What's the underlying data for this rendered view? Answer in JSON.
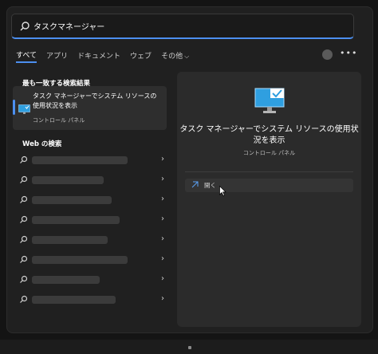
{
  "search": {
    "query": "タスクマネージャー",
    "placeholder": ""
  },
  "tabs": [
    {
      "label": "すべて"
    },
    {
      "label": "アプリ"
    },
    {
      "label": "ドキュメント"
    },
    {
      "label": "ウェブ"
    },
    {
      "label": "その他",
      "chevron": "chevron-down-icon"
    }
  ],
  "header": {
    "more": "•••"
  },
  "left": {
    "best_match_heading": "最も一致する検索結果",
    "best_match": {
      "title": "タスク マネージャーでシステム リソースの使用状況を表示",
      "subtitle": "コントロール パネル",
      "icon": "monitor-check-icon"
    },
    "web_heading": "Web の検索",
    "web_results_count_visible": 8
  },
  "detail": {
    "title": "タスク マネージャーでシステム リソースの使用状況を表示",
    "subtitle": "コントロール パネル",
    "actions": [
      {
        "label": "開く",
        "icon": "open-icon"
      }
    ]
  },
  "colors": {
    "accent": "#4c8ff0",
    "panel": "#202020",
    "detail": "#2b2b2b"
  }
}
